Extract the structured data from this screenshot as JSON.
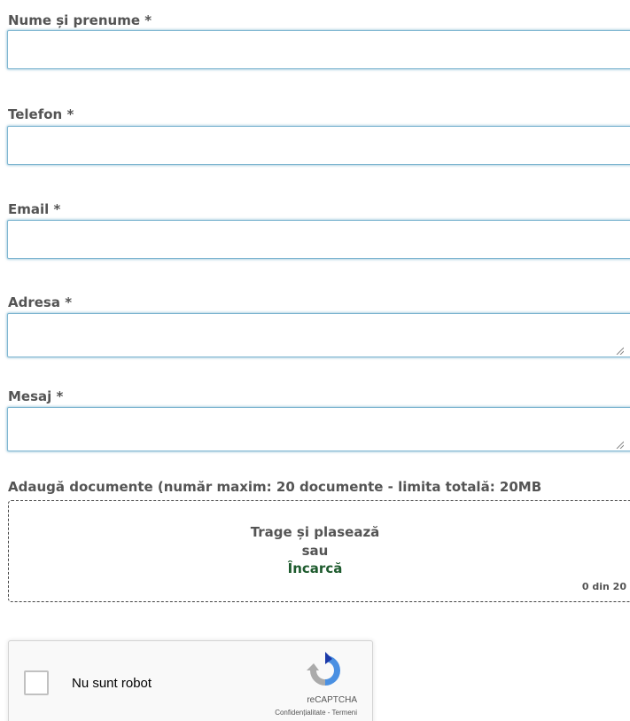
{
  "form": {
    "fields": [
      {
        "label": "Nume și prenume *",
        "value": ""
      },
      {
        "label": "Telefon *",
        "value": ""
      },
      {
        "label": "Email *",
        "value": ""
      },
      {
        "label": "Adresa *",
        "value": ""
      },
      {
        "label": "Mesaj *",
        "value": ""
      }
    ],
    "upload": {
      "label": "Adaugă documente (număr maxim: 20 documente - limita totală: 20MB",
      "drag_text": "Trage și plasează",
      "or_text": "sau",
      "upload_link": "Încarcă",
      "counter": "0 din 20"
    },
    "recaptcha": {
      "checkbox_text": "Nu sunt robot",
      "brand": "reCAPTCHA",
      "links": "Confidențialitate - Termeni"
    }
  }
}
